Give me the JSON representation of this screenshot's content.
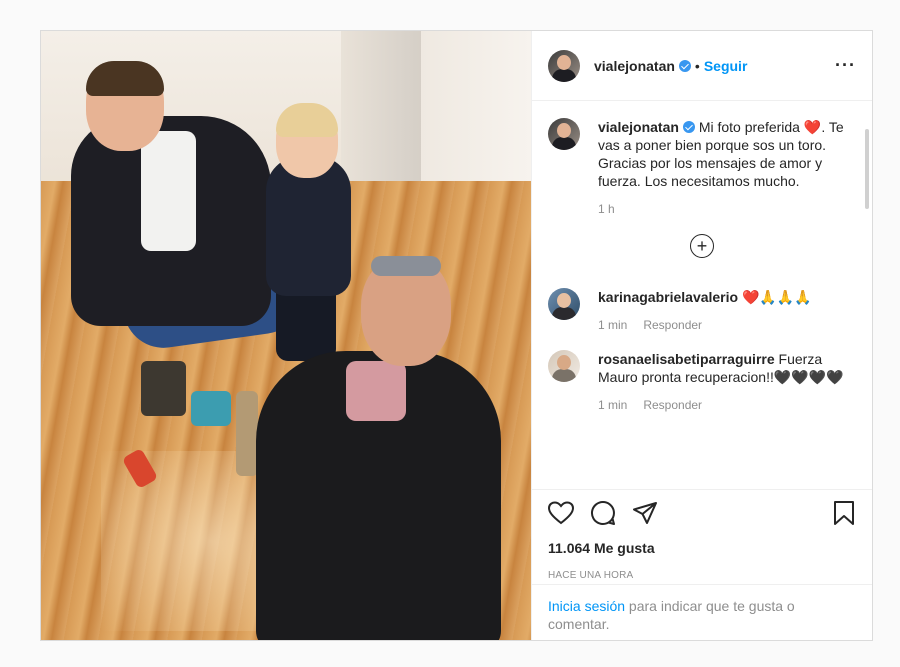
{
  "post": {
    "photo_alt": "",
    "header": {
      "username": "vialejonatan",
      "separator": "•",
      "follow_label": "Seguir",
      "more_label": "..."
    },
    "caption": {
      "username": "vialejonatan",
      "text_1": "Mi foto preferida ",
      "heart": "❤️",
      "text_2": ". Te vas a poner bien porque sos un toro.",
      "text_3": "Gracias por los mensajes de amor y fuerza. Los necesitamos mucho.",
      "time": "1 h"
    },
    "load_more_icon": "plus-circle-icon",
    "comments": [
      {
        "username": "karinagabrielavalerio",
        "text": "❤️🙏🙏🙏",
        "time": "1 min",
        "reply_label": "Responder"
      },
      {
        "username": "rosanaelisabetiparraguirre",
        "text": "Fuerza Mauro pronta recuperacion!!🖤🖤🖤🖤",
        "time": "1 min",
        "reply_label": "Responder"
      }
    ],
    "actions": {
      "icons": [
        "heart-icon",
        "comment-icon",
        "share-icon",
        "bookmark-icon"
      ],
      "likes": "11.064 Me gusta",
      "timestamp": "Hace una hora"
    },
    "login": {
      "link": "Inicia sesión",
      "text": " para indicar que te gusta o comentar."
    }
  }
}
